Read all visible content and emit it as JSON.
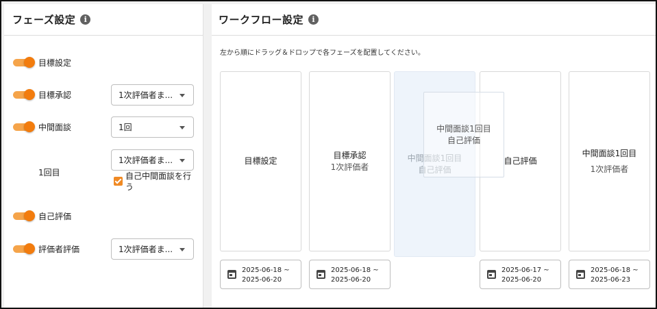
{
  "phase_panel": {
    "title": "フェーズ設定",
    "info_icon": "i",
    "rows": [
      {
        "label": "目標設定",
        "toggle_on": true
      },
      {
        "label": "目標承認",
        "toggle_on": true,
        "select_value": "1次評価者ま..."
      },
      {
        "label": "中間面談",
        "toggle_on": true,
        "select_value": "1回"
      },
      {
        "label": "1回目",
        "select_value": "1次評価者ま...",
        "checkbox_label": "自己中間面談を行う",
        "checkbox_checked": true
      },
      {
        "label": "自己評価",
        "toggle_on": true
      },
      {
        "label": "評価者評価",
        "toggle_on": true,
        "select_value": "1次評価者ま..."
      }
    ]
  },
  "workflow_panel": {
    "title": "ワークフロー設定",
    "info_icon": "i",
    "instruction": "左から順にドラッグ＆ドロップで各フェーズを配置してください。",
    "cards": [
      {
        "title": "目標設定",
        "sub": "",
        "date_from": "2025-06-18 ~",
        "date_to": "2025-06-20"
      },
      {
        "title": "目標承認",
        "sub": "1次評価者",
        "date_from": "2025-06-18 ~",
        "date_to": "2025-06-20"
      },
      {
        "title": "自己評価",
        "sub": "",
        "date_from": "2025-06-17 ~",
        "date_to": "2025-06-20"
      },
      {
        "title": "中間面談1回目",
        "sub": "1次評価者",
        "date_from": "2025-06-18 ~",
        "date_to": "2025-06-23"
      }
    ],
    "drop_placeholder": {
      "title": "中間面談1回目",
      "sub": "自己評価"
    },
    "dragging_card": {
      "title": "中間面談1回目",
      "sub": "自己評価"
    }
  },
  "colors": {
    "toggle_accent": "#f27c0e",
    "checkbox": "#f08a24",
    "placeholder_bg": "#eef4fb"
  },
  "icons": {
    "info": "info-icon",
    "calendar": "calendar-icon",
    "caret": "caret-down-icon"
  }
}
